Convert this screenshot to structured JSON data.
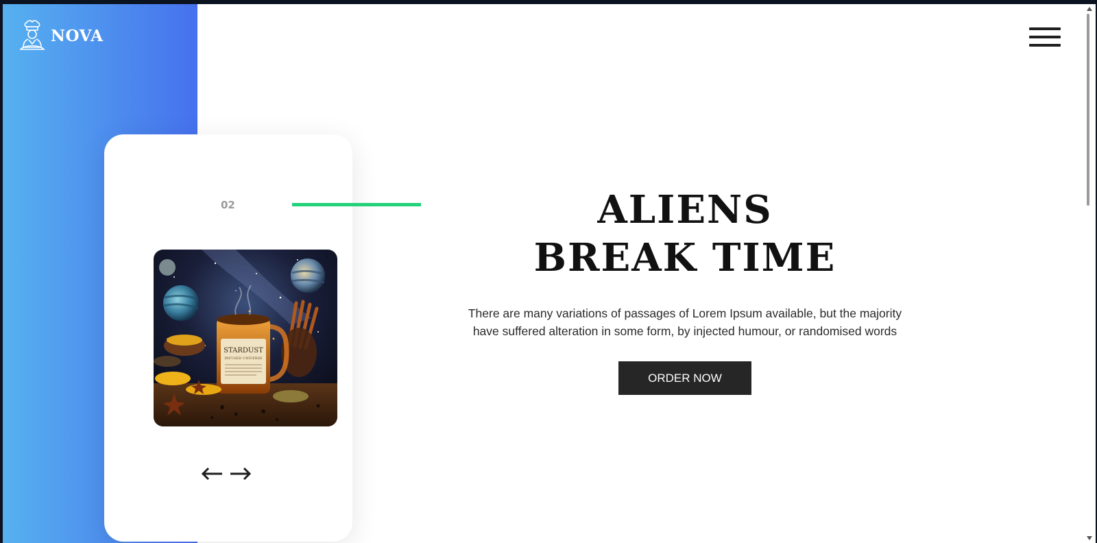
{
  "brand": {
    "name": "NOVA",
    "logo_icon": "chef-icon"
  },
  "menu": {
    "icon": "hamburger-icon"
  },
  "slider": {
    "current": "02",
    "prev_icon": "arrow-left-icon",
    "next_icon": "arrow-right-icon",
    "image": {
      "label_title": "STARDUST",
      "label_subtitle": "INFUSED UNIVERSE"
    }
  },
  "hero": {
    "title_line1": "ALIENS",
    "title_line2": "BREAK TIME",
    "description": "There are many variations of passages of Lorem Ipsum available, but the majority have suffered alteration in some form, by injected humour, or randomised words",
    "cta_label": "ORDER NOW"
  },
  "colors": {
    "gradient_start": "#56b1ef",
    "gradient_end": "#4671ee",
    "accent_line": "#22d27a",
    "cta_bg": "#262626"
  }
}
